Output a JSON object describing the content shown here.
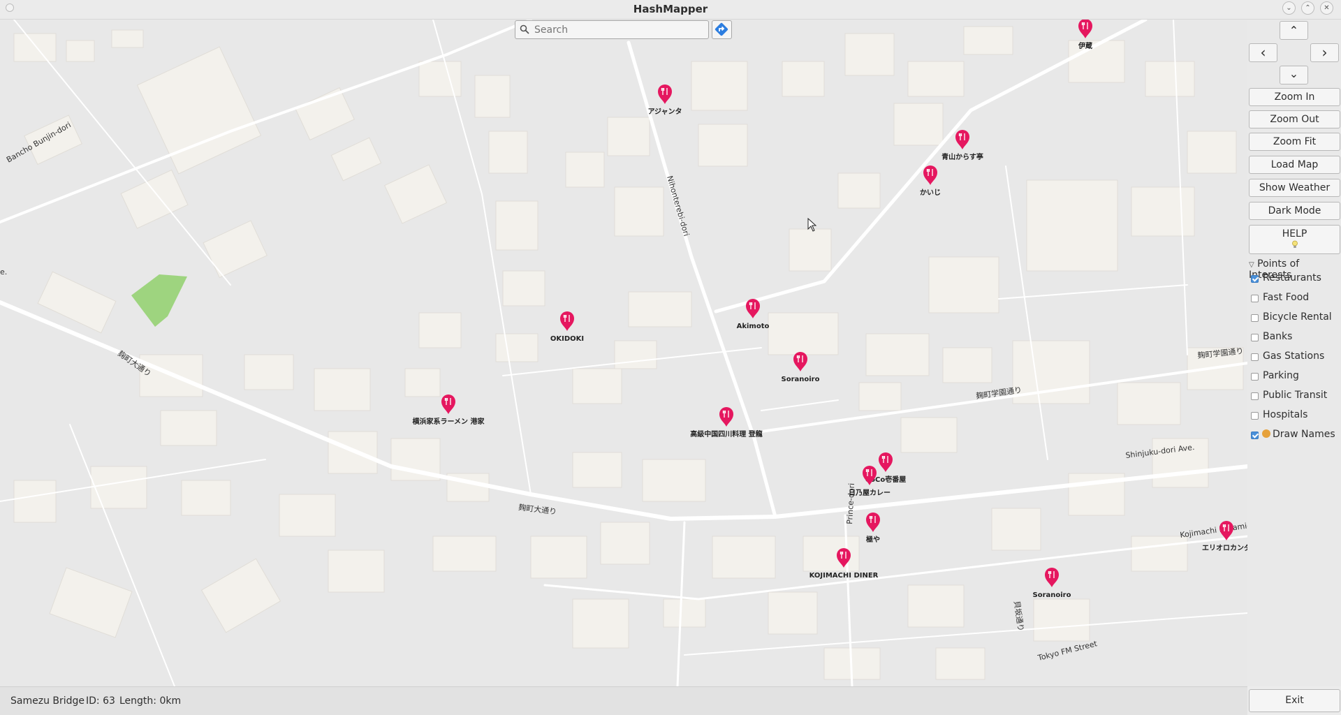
{
  "window": {
    "title": "HashMapper"
  },
  "search": {
    "placeholder": "Search"
  },
  "nav": {
    "up": "⌃",
    "left": "‹",
    "right": "›",
    "down": "⌄"
  },
  "sidebar": {
    "zoom_in": "Zoom In",
    "zoom_out": "Zoom Out",
    "zoom_fit": "Zoom Fit",
    "load_map": "Load Map",
    "show_weather": "Show Weather",
    "dark_mode": "Dark Mode",
    "help": "HELP",
    "poi_header": "Points of Interests",
    "poi_items": [
      {
        "label": "Restaurants",
        "checked": true
      },
      {
        "label": "Fast Food",
        "checked": false
      },
      {
        "label": "Bicycle Rental",
        "checked": false
      },
      {
        "label": "Banks",
        "checked": false
      },
      {
        "label": "Gas Stations",
        "checked": false
      },
      {
        "label": "Parking",
        "checked": false
      },
      {
        "label": "Public Transit",
        "checked": false
      },
      {
        "label": "Hospitals",
        "checked": false
      },
      {
        "label": "Draw Names",
        "checked": true
      }
    ],
    "exit": "Exit"
  },
  "status": {
    "name": "Samezu Bridge",
    "id": "ID: 63",
    "length": "Length: 0km"
  },
  "map": {
    "poi_color": "#e5175f",
    "restaurants": [
      "アジャンタ",
      "伊蔵",
      "青山からす亭",
      "かいじ",
      "Akimoto",
      "OKIDOKI",
      "Soranoiro",
      "横浜家系ラーメン 港家",
      "高級中国四川料理 登龍",
      "CoCo壱番屋",
      "日乃屋カレー",
      "極や",
      "KOJIMACHI DINER",
      "エリオロカンダ",
      "Soranoiro"
    ],
    "streets": [
      "Bancho Bunjin-dori",
      "Nihonterebi-dori",
      "麹町大通り",
      "麹町大通り",
      "麹町学園通り",
      "麹町学園通り",
      "Shinjuku-dori Ave.",
      "Prince-dori",
      "Kojimachi Minami-d",
      "貝坂通り",
      "Tokyo FM Street",
      "e."
    ]
  }
}
